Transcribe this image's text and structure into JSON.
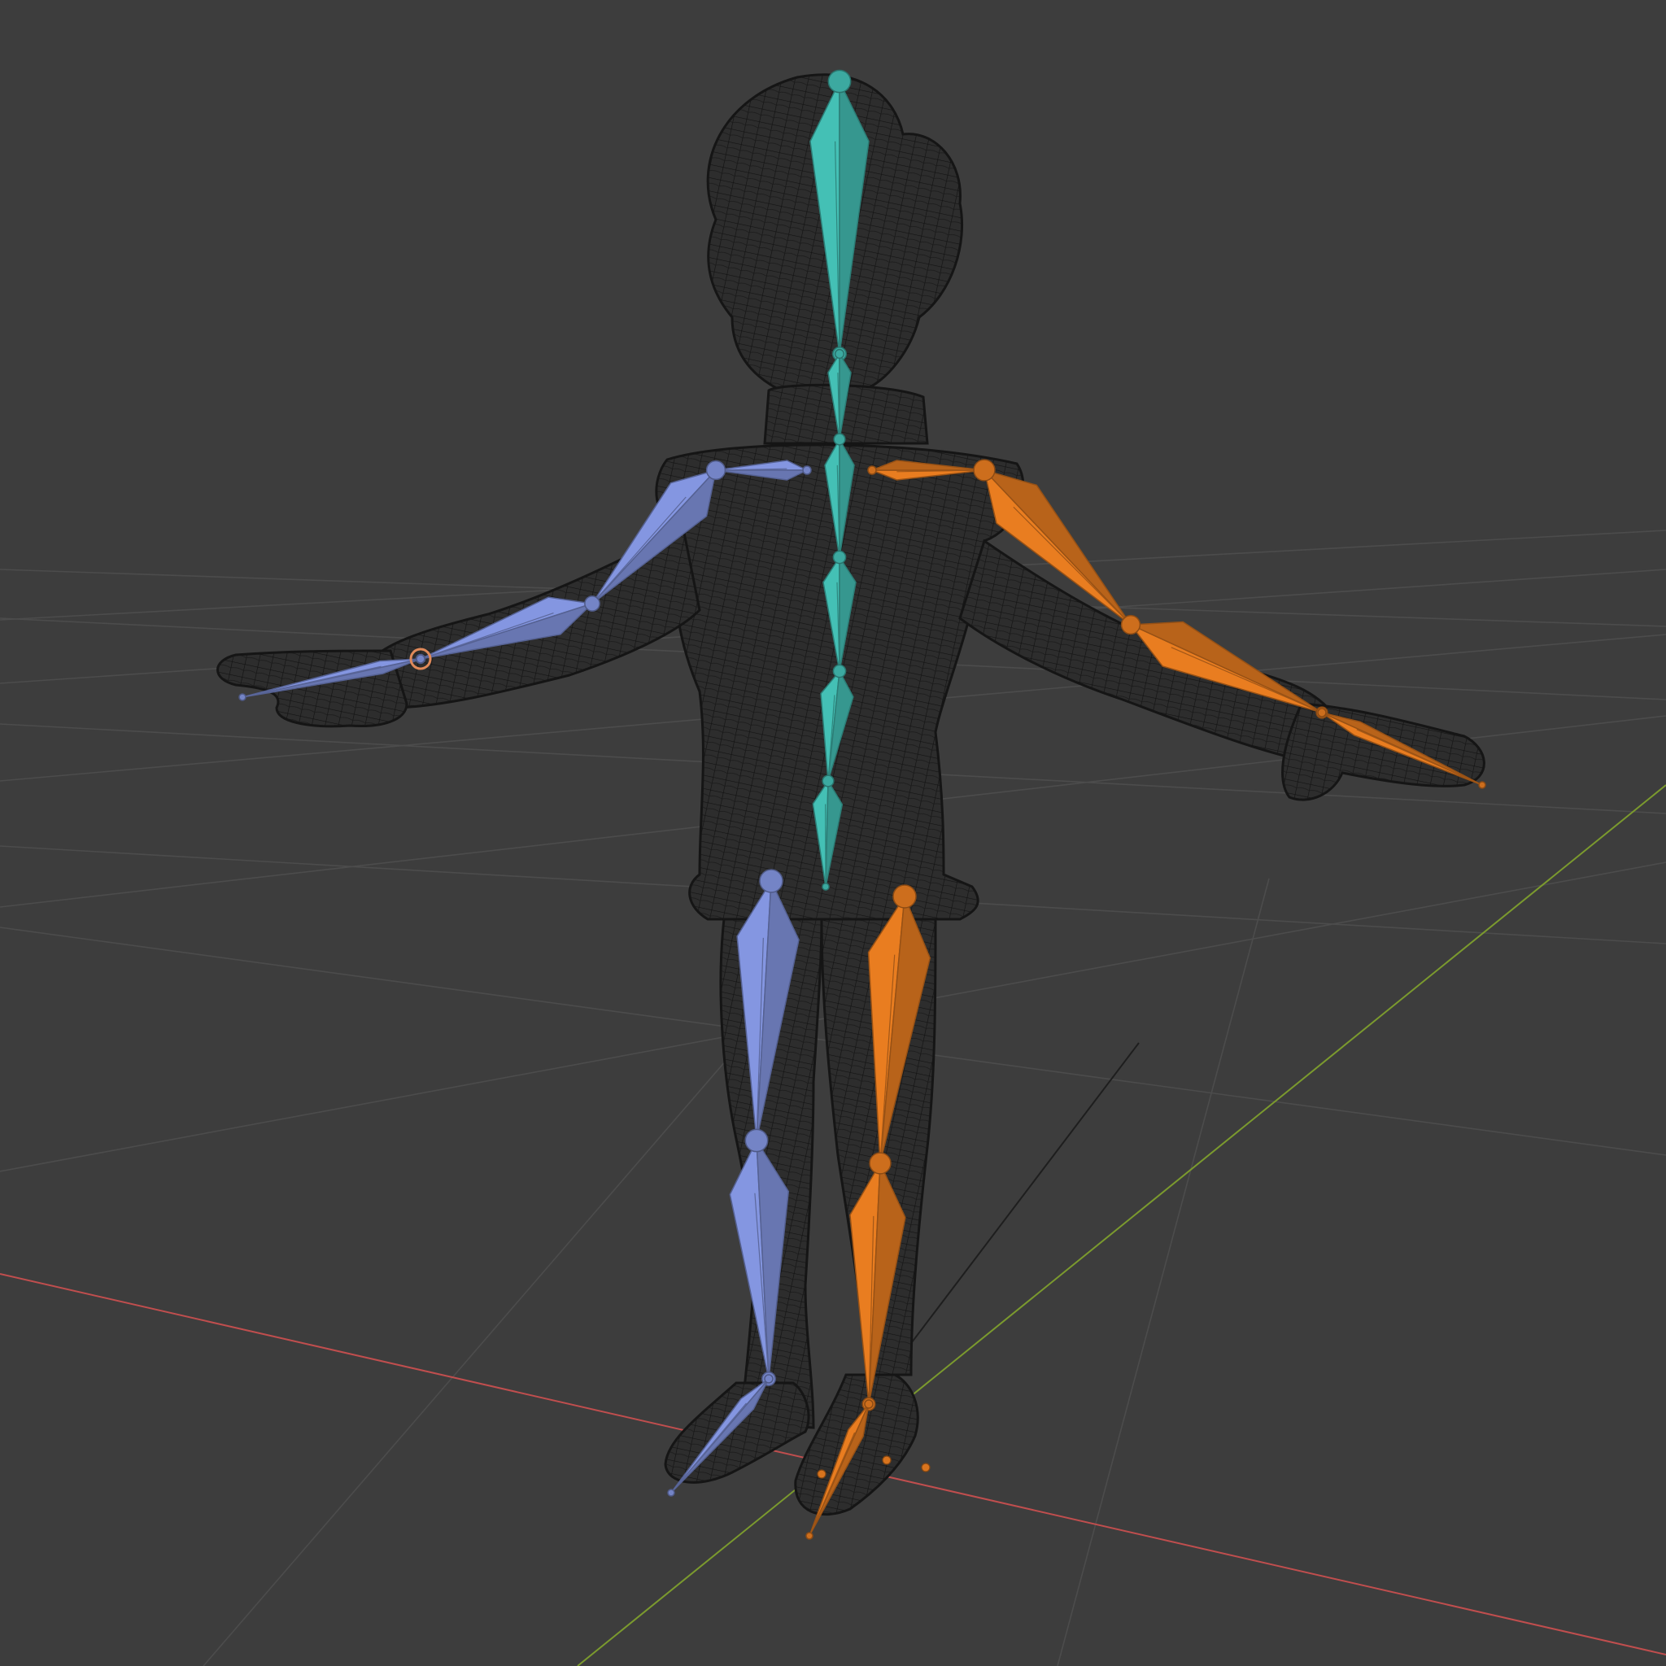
{
  "viewport": {
    "background_color": "#3d3d3d",
    "grid_color": "#4c4c4c",
    "x_axis_color": "#c04e4e",
    "y_axis_color": "#7b9a2e",
    "z_axis_color": "#1e1e1e"
  },
  "mesh": {
    "display": "wireframe",
    "wire_color": "#141414",
    "fill_color": "#2e2e2e"
  },
  "armature": {
    "bone_display": "octahedral",
    "colors": {
      "spine": "#3fb2a8",
      "left_side": "#7a8bd0",
      "right_side": "#d8741e",
      "highlight_joint": "#e08a5a"
    },
    "bones": [
      {
        "name": "head",
        "group": "spine"
      },
      {
        "name": "neck",
        "group": "spine"
      },
      {
        "name": "spine-upper",
        "group": "spine"
      },
      {
        "name": "spine-mid",
        "group": "spine"
      },
      {
        "name": "spine-lower",
        "group": "spine"
      },
      {
        "name": "hips",
        "group": "spine"
      },
      {
        "name": "shoulder-l",
        "group": "left_side"
      },
      {
        "name": "upperarm-l",
        "group": "left_side"
      },
      {
        "name": "forearm-l",
        "group": "left_side"
      },
      {
        "name": "hand-l",
        "group": "left_side"
      },
      {
        "name": "thigh-l",
        "group": "left_side"
      },
      {
        "name": "shin-l",
        "group": "left_side"
      },
      {
        "name": "foot-l",
        "group": "left_side"
      },
      {
        "name": "shoulder-r",
        "group": "right_side"
      },
      {
        "name": "upperarm-r",
        "group": "right_side"
      },
      {
        "name": "forearm-r",
        "group": "right_side"
      },
      {
        "name": "hand-r",
        "group": "right_side"
      },
      {
        "name": "thigh-r",
        "group": "right_side"
      },
      {
        "name": "shin-r",
        "group": "right_side"
      },
      {
        "name": "foot-r",
        "group": "right_side"
      }
    ]
  }
}
